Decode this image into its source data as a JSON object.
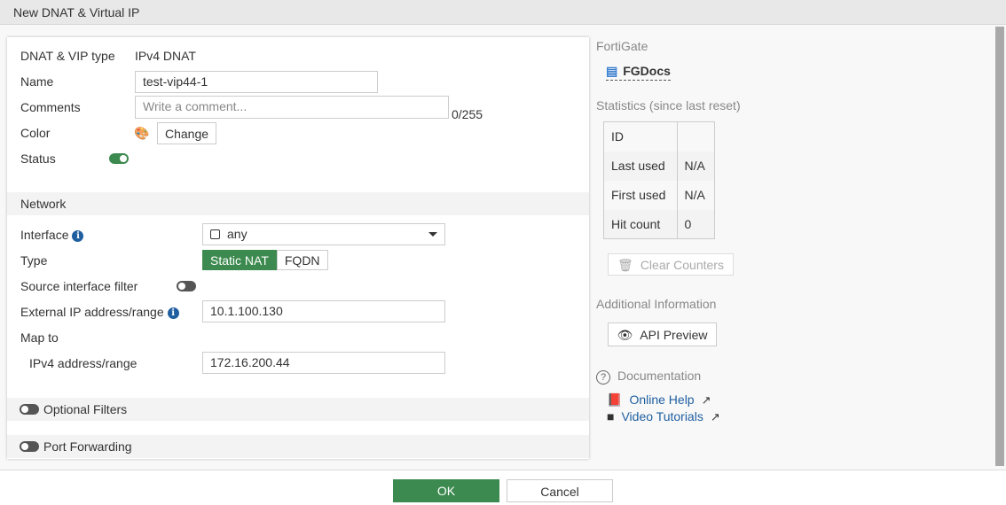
{
  "window": {
    "title": "New DNAT & Virtual IP"
  },
  "form": {
    "type_label": "DNAT & VIP type",
    "type_value": "IPv4 DNAT",
    "name_label": "Name",
    "name_value": "test-vip44-1",
    "comments_label": "Comments",
    "comments_placeholder": "Write a comment...",
    "comments_count": "0/255",
    "color_label": "Color",
    "color_change": "Change",
    "status_label": "Status",
    "status_enabled": true
  },
  "network": {
    "header": "Network",
    "interface_label": "Interface",
    "interface_value": "any",
    "type_label": "Type",
    "type_options": [
      "Static NAT",
      "FQDN"
    ],
    "type_selected": "Static NAT",
    "source_filter_label": "Source interface filter",
    "source_filter_enabled": false,
    "external_label": "External IP address/range",
    "external_value": "10.1.100.130",
    "map_to_label": "Map to",
    "ipv4_label": "IPv4 address/range",
    "ipv4_value": "172.16.200.44"
  },
  "optional_filters": {
    "label": "Optional Filters",
    "enabled": false
  },
  "port_forwarding": {
    "label": "Port Forwarding",
    "enabled": false
  },
  "sidebar": {
    "fortigate_header": "FortiGate",
    "device": "FGDocs",
    "stats_header": "Statistics (since last reset)",
    "stats": [
      {
        "k": "ID",
        "v": ""
      },
      {
        "k": "Last used",
        "v": "N/A"
      },
      {
        "k": "First used",
        "v": "N/A"
      },
      {
        "k": "Hit count",
        "v": "0"
      }
    ],
    "clear_counters": "Clear Counters",
    "additional_header": "Additional Information",
    "api_preview": "API Preview",
    "documentation_header": "Documentation",
    "online_help": "Online Help",
    "video_tutorials": "Video Tutorials"
  },
  "footer": {
    "ok": "OK",
    "cancel": "Cancel"
  },
  "colors": {
    "accent": "#3c8a4f",
    "link": "#1f5fa0"
  }
}
